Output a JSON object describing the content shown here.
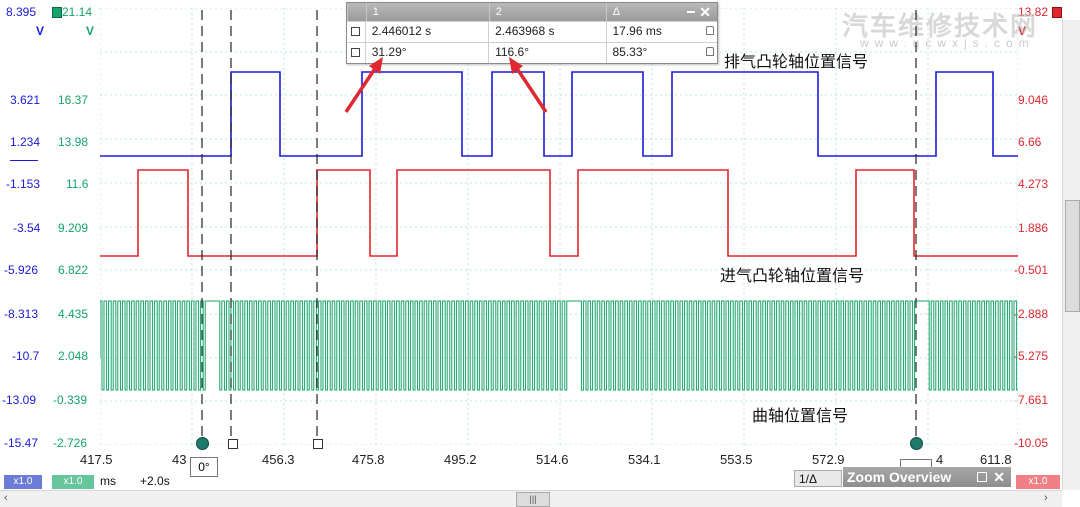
{
  "axes": {
    "left_blue": [
      "8.395",
      "3.621",
      "1.234",
      "-1.153",
      "-3.54",
      "-5.926",
      "-8.313",
      "-10.7",
      "-13.09",
      "-15.47"
    ],
    "left_green": [
      "21.14",
      "16.37",
      "13.98",
      "11.6",
      "9.209",
      "6.822",
      "4.435",
      "2.048",
      "-0.339",
      "-2.726"
    ],
    "right_red": [
      "13.82",
      "9.046",
      "6.66",
      "4.273",
      "1.886",
      "-0.501",
      "-2.888",
      "-5.275",
      "-7.661",
      "-10.05"
    ],
    "left_blue_unit": "V",
    "left_green_unit": "V",
    "right_red_unit": "V",
    "x_ticks": [
      "417.5",
      "43",
      "456.3",
      "475.8",
      "495.2",
      "514.6",
      "534.1",
      "553.5",
      "572.9",
      "611.8"
    ],
    "x_hidden_tick": "4"
  },
  "colors": {
    "blue": "#1a1adb",
    "red": "#e0262f",
    "green": "#16a36a",
    "grid": "#bfe3ea"
  },
  "cursor_table": {
    "head": [
      "1",
      "2",
      "Δ"
    ],
    "row1": [
      "2.446012 s",
      "2.463968 s",
      "17.96 ms"
    ],
    "row2": [
      "31.29°",
      "116.6°",
      "85.33°"
    ]
  },
  "labels": {
    "exhaust": "排气凸轮轴位置信号",
    "intake": "进气凸轮轴位置信号",
    "crank": "曲轴位置信号",
    "rotation_marker": "0°"
  },
  "bottom": {
    "scale_blue": "x1.0",
    "scale_green": "x1.0",
    "scale_red": "x1.0",
    "unit": "ms",
    "offset": "+2.0s",
    "page": "1/Δ",
    "zoom_title": "Zoom Overview",
    "scroll_grip": "|||"
  },
  "watermark": {
    "text": "汽车维修技术网",
    "url": "www.qcwxjs.com"
  }
}
